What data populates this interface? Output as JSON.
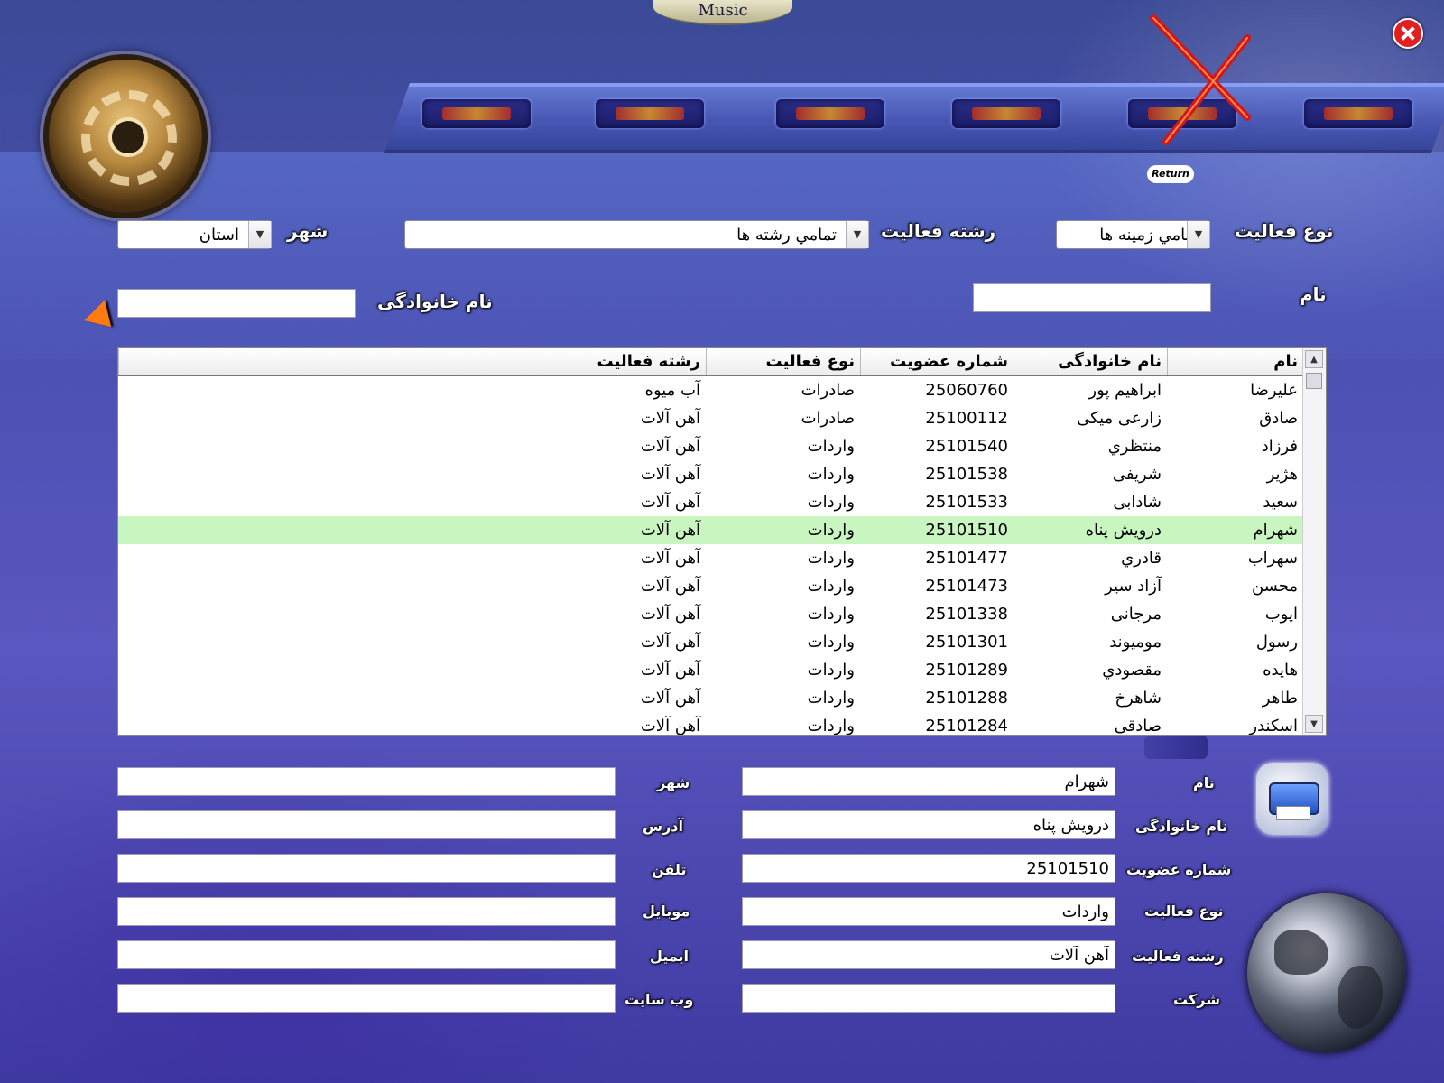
{
  "music_label": "Music",
  "return_label": "Return",
  "filters": {
    "activity_type_label": "نوع فعالیت",
    "activity_type_value": "تمامي زمينه ها",
    "activity_field_label": "رشته فعالیت",
    "activity_field_value": "تمامي رشته ها",
    "city_label": "شهر",
    "city_value": "استان",
    "name_label": "نام",
    "name_value": "",
    "family_label": "نام خانوادگی",
    "family_value": ""
  },
  "table": {
    "columns": [
      "نام",
      "نام خانوادگی",
      "شماره عضويت",
      "نوع فعالیت",
      "رشته فعالیت"
    ],
    "rows": [
      {
        "name": "عليرضا",
        "family": "ابراهيم پور",
        "member": "25060760",
        "type": "صادرات",
        "field": "آب میوه"
      },
      {
        "name": "صادق",
        "family": "زارعی میکی",
        "member": "25100112",
        "type": "صادرات",
        "field": "آهن آلات"
      },
      {
        "name": "فرزاد",
        "family": "منتظري",
        "member": "25101540",
        "type": "واردات",
        "field": "آهن آلات"
      },
      {
        "name": "هژير",
        "family": "شريفی",
        "member": "25101538",
        "type": "واردات",
        "field": "آهن آلات"
      },
      {
        "name": "سعيد",
        "family": "شادابی",
        "member": "25101533",
        "type": "واردات",
        "field": "آهن آلات"
      },
      {
        "name": "شهرام",
        "family": "درویش پناه",
        "member": "25101510",
        "type": "واردات",
        "field": "آهن آلات"
      },
      {
        "name": "سهراب",
        "family": "قادري",
        "member": "25101477",
        "type": "واردات",
        "field": "آهن آلات"
      },
      {
        "name": "محسن",
        "family": "آزاد سير",
        "member": "25101473",
        "type": "واردات",
        "field": "آهن آلات"
      },
      {
        "name": "ايوب",
        "family": "مرجانی",
        "member": "25101338",
        "type": "واردات",
        "field": "آهن آلات"
      },
      {
        "name": "رسول",
        "family": "موميوند",
        "member": "25101301",
        "type": "واردات",
        "field": "آهن آلات"
      },
      {
        "name": "هايده",
        "family": "مقصودي",
        "member": "25101289",
        "type": "واردات",
        "field": "آهن آلات"
      },
      {
        "name": "طاهر",
        "family": "شاهرخ",
        "member": "25101288",
        "type": "واردات",
        "field": "آهن آلات"
      },
      {
        "name": "اسکندر",
        "family": "صادقی",
        "member": "25101284",
        "type": "واردات",
        "field": "آهن آلات"
      }
    ],
    "selected_index": 5
  },
  "details": {
    "name_label": "نام",
    "name_value": "شهرام",
    "family_label": "نام خانوادگی",
    "family_value": "درویش پناه",
    "member_label": "شماره عضويت",
    "member_value": "25101510",
    "type_label": "نوع فعالیت",
    "type_value": "واردات",
    "field_label": "رشته فعالیت",
    "field_value": "آهن آلات",
    "company_label": "شرکت",
    "company_value": "",
    "city_label": "شهر",
    "city_value": "",
    "address_label": "آدرس",
    "address_value": "",
    "phone_label": "تلفن",
    "phone_value": "",
    "mobile_label": "موبايل",
    "mobile_value": "",
    "email_label": "ايميل",
    "email_value": "",
    "website_label": "وب سايت",
    "website_value": ""
  },
  "icons": {
    "close": "close-icon",
    "return": "return-x-icon",
    "logo": "logo-emblem",
    "printer": "printer-icon",
    "globe": "globe-icon",
    "arrow": "pointer-arrow-icon"
  },
  "colors": {
    "selected_row": "#c8f5c0",
    "close_red": "#e02020",
    "return_x_red": "#d01818"
  }
}
